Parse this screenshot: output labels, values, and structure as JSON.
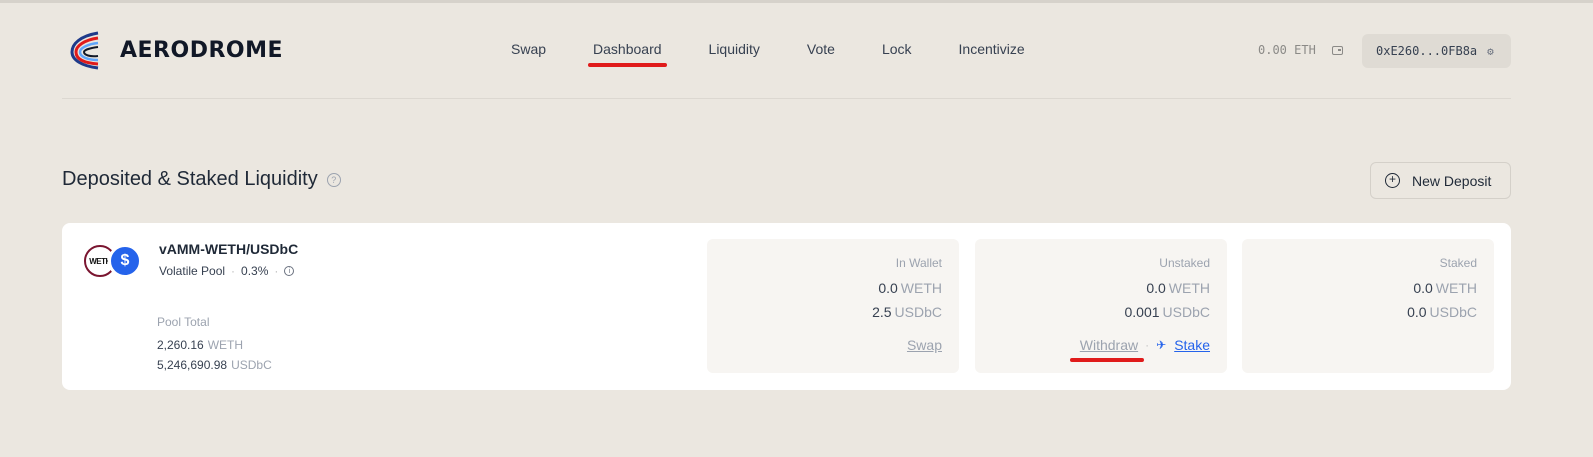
{
  "header": {
    "brand": "AERODROME",
    "nav": [
      "Swap",
      "Dashboard",
      "Liquidity",
      "Vote",
      "Lock",
      "Incentivize"
    ],
    "active_nav": "Dashboard",
    "balance": "0.00 ETH",
    "account": "0xE260...0FB8a"
  },
  "section": {
    "title": "Deposited & Staked Liquidity",
    "new_deposit_label": "New Deposit"
  },
  "pool": {
    "token_a_badge": "WETH",
    "token_b_badge": "$",
    "name": "vAMM-WETH/USDbC",
    "type": "Volatile Pool",
    "fee": "0.3%",
    "total_label": "Pool Total",
    "total_weth": "2,260.16",
    "total_weth_sym": "WETH",
    "total_usdbc": "5,246,690.98",
    "total_usdbc_sym": "USDbC"
  },
  "in_wallet": {
    "label": "In Wallet",
    "weth": "0.0",
    "weth_sym": "WETH",
    "usdbc": "2.5",
    "usdbc_sym": "USDbC",
    "action": "Swap"
  },
  "unstaked": {
    "label": "Unstaked",
    "weth": "0.0",
    "weth_sym": "WETH",
    "usdbc": "0.001",
    "usdbc_sym": "USDbC",
    "withdraw": "Withdraw",
    "stake": "Stake"
  },
  "staked": {
    "label": "Staked",
    "weth": "0.0",
    "weth_sym": "WETH",
    "usdbc": "0.0",
    "usdbc_sym": "USDbC"
  },
  "colors": {
    "accent_red": "#e01b1b",
    "link_blue": "#2563eb",
    "background": "#ebe7e0"
  }
}
